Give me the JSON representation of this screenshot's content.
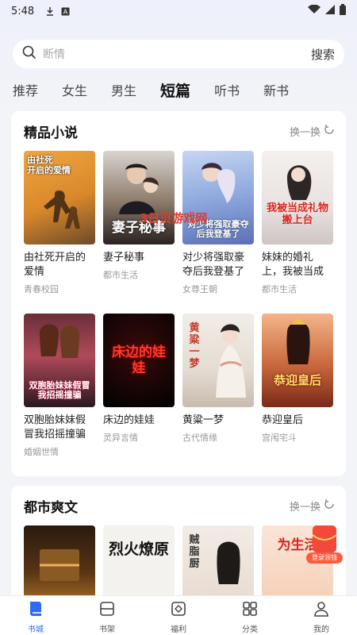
{
  "status_bar": {
    "time": "5:48"
  },
  "search": {
    "placeholder": "断情",
    "button_label": "搜索"
  },
  "tabs": [
    {
      "label": "推荐",
      "active": false
    },
    {
      "label": "女生",
      "active": false
    },
    {
      "label": "男生",
      "active": false
    },
    {
      "label": "短篇",
      "active": true
    },
    {
      "label": "听书",
      "active": false
    },
    {
      "label": "新书",
      "active": false
    }
  ],
  "sections": [
    {
      "title": "精品小说",
      "refresh_label": "换一换",
      "books": [
        {
          "title": "由社死开启的爱情",
          "genre": "青春校园",
          "cover_text": "由社死\n开启的爱情"
        },
        {
          "title": "妻子秘事",
          "genre": "都市生活",
          "cover_text": "妻子秘事"
        },
        {
          "title": "对少将强取豪夺后我登基了",
          "genre": "女尊王朝",
          "cover_text": "对少将强取豪夺后我登基了"
        },
        {
          "title": "妹妹的婚礼上，我被当成礼物搬上台",
          "genre": "都市生活",
          "cover_text": "我被当成礼物搬上台"
        },
        {
          "title": "双胞胎妹妹假冒我招摇撞骗",
          "genre": "婚姻世情",
          "cover_text": "双胞胎妹妹假冒我招摇撞骗"
        },
        {
          "title": "床边的娃娃",
          "genre": "灵异言情",
          "cover_text": "床边的娃娃"
        },
        {
          "title": "黄粱一梦",
          "genre": "古代情缘",
          "cover_text": "黄粱一梦"
        },
        {
          "title": "恭迎皇后",
          "genre": "宫闱宅斗",
          "cover_text": "恭迎皇后"
        }
      ]
    },
    {
      "title": "都市爽文",
      "refresh_label": "换一换",
      "books": [
        {
          "cover_text": ""
        },
        {
          "cover_text": "烈火燎原"
        },
        {
          "cover_text": "贼脂厨"
        },
        {
          "cover_text": "为生活"
        }
      ]
    }
  ],
  "watermark": "3日贝游戏网",
  "gift_label": "登录领钱",
  "bottom_nav": [
    {
      "label": "书城",
      "icon": "book-icon",
      "active": true
    },
    {
      "label": "书架",
      "icon": "bookshelf-icon",
      "active": false
    },
    {
      "label": "福利",
      "icon": "gift-diamond-icon",
      "active": false
    },
    {
      "label": "分类",
      "icon": "grid-icon",
      "active": false
    },
    {
      "label": "我的",
      "icon": "person-icon",
      "active": false
    }
  ],
  "colors": {
    "accent": "#2b6cf0",
    "background": "#f3f4f8",
    "watermark": "#e13a2c"
  }
}
